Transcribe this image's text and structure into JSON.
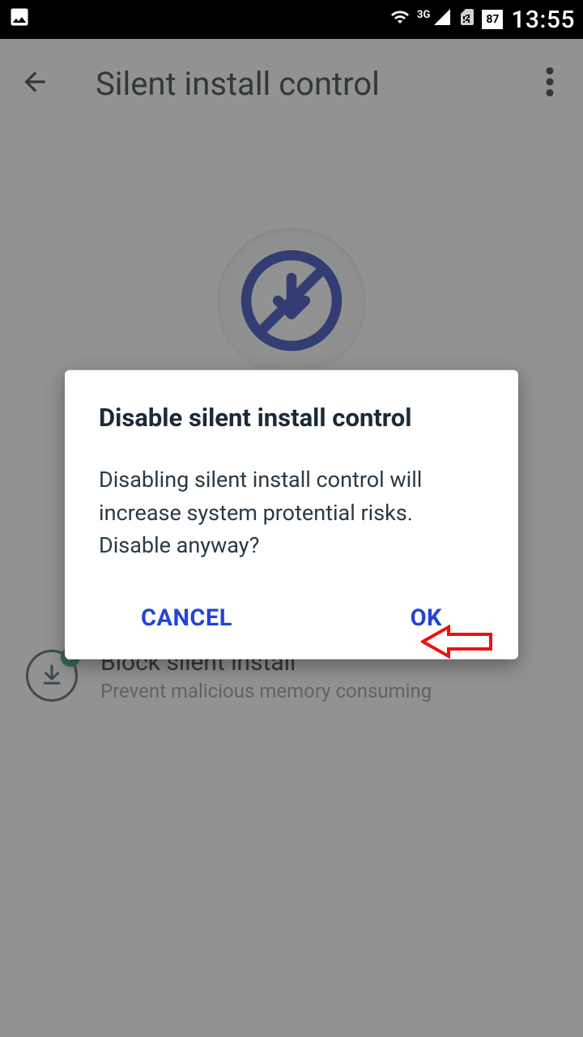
{
  "status": {
    "network_label": "3G",
    "battery_pct": "87",
    "time": "13:55"
  },
  "appbar": {
    "title": "Silent install control"
  },
  "list": {
    "item1": {
      "title": "Block silent install",
      "subtitle": "Prevent malicious memory consuming"
    }
  },
  "dialog": {
    "title": "Disable silent install control",
    "body": "Disabling silent install control will increase system protential risks. Disable anyway?",
    "cancel_label": "CANCEL",
    "ok_label": "OK"
  }
}
